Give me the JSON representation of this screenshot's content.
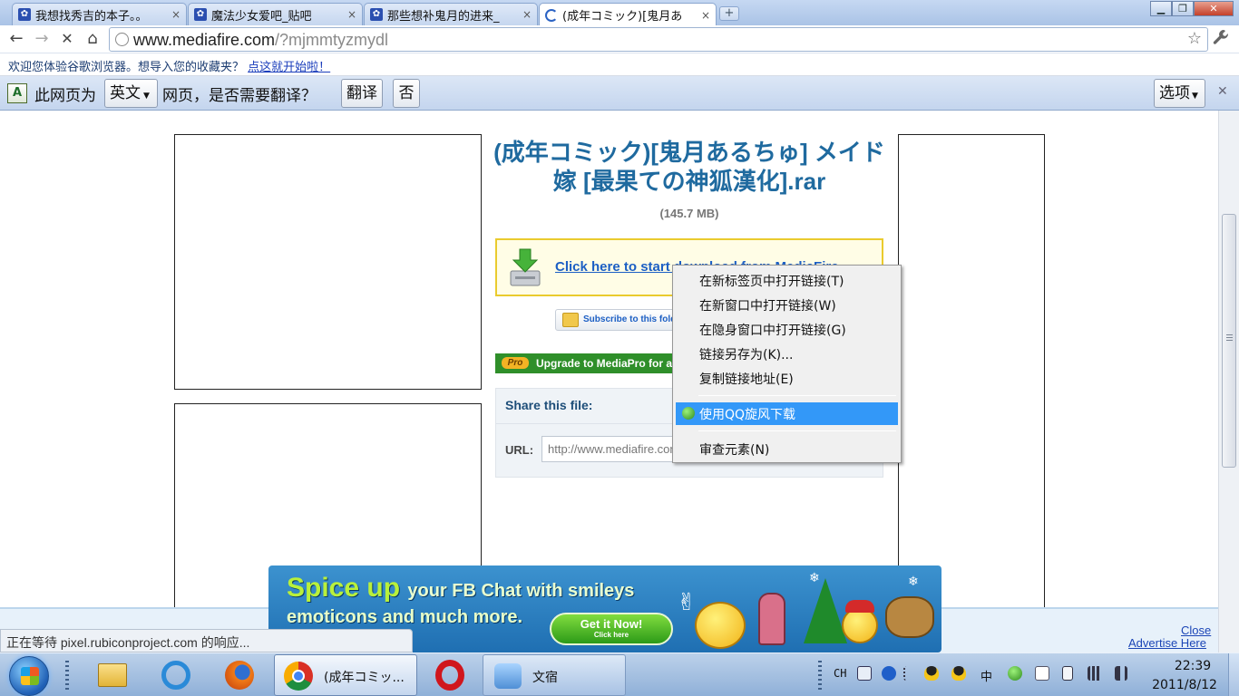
{
  "window": {
    "tabs": [
      {
        "title": "我想找秀吉的本子。。",
        "favicon": "baidu-paw-icon",
        "active": false
      },
      {
        "title": "魔法少女爱吧_贴吧",
        "favicon": "baidu-paw-icon",
        "active": false
      },
      {
        "title": "那些想补鬼月的进来_",
        "favicon": "baidu-paw-icon",
        "active": false
      },
      {
        "title": "(成年コミック)[鬼月あ",
        "favicon": "loading-spinner-icon",
        "active": true
      }
    ],
    "tab_close_glyph": "×",
    "new_tab_glyph": "+",
    "controls": {
      "minimize": "▁",
      "maximize": "❐",
      "close": "✕"
    }
  },
  "toolbar": {
    "back_glyph": "←",
    "forward_glyph": "→",
    "stop_glyph": "✕",
    "home_glyph": "⌂",
    "url_host": "www.mediafire.com",
    "url_path": "/?mjmmtyzmydl",
    "star_glyph": "☆",
    "wrench_glyph": "🔧"
  },
  "bookmark_bar": {
    "text": "欢迎您体验谷歌浏览器。想导入您的收藏夹？",
    "link": "点这就开始啦！"
  },
  "translate_bar": {
    "icon": "translate-icon",
    "prefix": "此网页为",
    "language": "英文",
    "suffix": "网页，是否需要翻译？",
    "translate_button": "翻译",
    "no_button": "否",
    "options_button": "选项",
    "close_glyph": "✕"
  },
  "page": {
    "file_title": "(成年コミック)[鬼月あるちゅ] メイド嫁 [最果ての神狐漢化].rar",
    "file_size": "(145.7 MB)",
    "download_link": "Click here to start download from MediaFire",
    "subscribe": "Subscribe to this folder",
    "upgrade_badge": "Pro",
    "upgrade_text": "Upgrade to MediaPro for ad-free downloads",
    "share_heading": "Share this file:",
    "url_label": "URL:",
    "url_value": "http://www.mediafire.com/?mjmmtyzmydl"
  },
  "ad": {
    "headline_big": "Spice up",
    "headline_rest": "your FB Chat with smileys",
    "subline": "emoticons and much more.",
    "cta_main": "Get it Now!",
    "cta_sub": "Click here",
    "close_link": "Close",
    "advertise_link": "Advertise Here"
  },
  "status_bubble": "正在等待 pixel.rubiconproject.com 的响应...",
  "context_menu": {
    "items": [
      "在新标签页中打开链接(T)",
      "在新窗口中打开链接(W)",
      "在隐身窗口中打开链接(G)",
      "链接另存为(K)...",
      "复制链接地址(E)",
      "使用QQ旋风下载",
      "审查元素(N)"
    ],
    "highlighted_index": 5
  },
  "taskbar": {
    "active_window_label": "(成年コミッ...",
    "second_window_label": "文宿",
    "tray": {
      "lang": "CH",
      "ime": "中"
    },
    "clock_time": "22:39",
    "clock_date": "2011/8/12"
  }
}
